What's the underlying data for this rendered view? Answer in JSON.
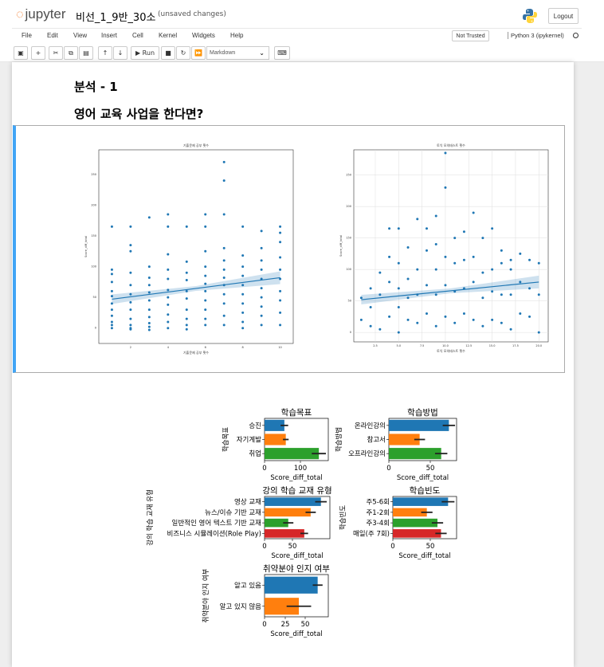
{
  "header": {
    "logo_text": "jupyter",
    "notebook_name": "비선_1_9반_30소",
    "save_status": "(unsaved changes)",
    "logout_label": "Logout"
  },
  "menubar": {
    "items": [
      "File",
      "Edit",
      "View",
      "Insert",
      "Cell",
      "Kernel",
      "Widgets",
      "Help"
    ],
    "trust_label": "Not Trusted",
    "kernel_label": "Python 3 (ipykernel)"
  },
  "toolbar": {
    "run_label": "Run",
    "cell_type": "Markdown",
    "icons": [
      "save-icon",
      "plus-icon",
      "cut-icon",
      "copy-icon",
      "paste-icon",
      "arrow-up-icon",
      "arrow-down-icon",
      "run-icon",
      "stop-icon",
      "restart-icon",
      "fast-forward-icon",
      "keyboard-icon"
    ]
  },
  "notebook": {
    "heading1": "분석 - 1",
    "heading2": "영어 교육 사업을 한다면?"
  },
  "colors": {
    "blue": "#1f77b4",
    "orange": "#ff7f0e",
    "green": "#2ca02c",
    "red": "#d62728",
    "cell_accent": "#42a5f5"
  },
  "chart_data": [
    {
      "type": "scatter",
      "title": "기출문제 공부 횟수",
      "xlabel": "기출문제 공부 횟수",
      "ylabel": "Score_diff_total",
      "xticks": [
        "2",
        "4",
        "6",
        "8",
        "10"
      ],
      "yticks": [
        "0",
        "50",
        "100",
        "150",
        "200",
        "250"
      ],
      "xlim": [
        0.3,
        10.7
      ],
      "ylim": [
        -25,
        290
      ],
      "regression": {
        "x": [
          1,
          10
        ],
        "y": [
          47,
          82
        ]
      },
      "x": [
        1,
        1,
        1,
        1,
        1,
        1,
        1,
        1,
        1,
        1,
        1,
        1,
        2,
        2,
        2,
        2,
        2,
        2,
        2,
        2,
        2,
        2,
        2,
        2,
        3,
        3,
        3,
        3,
        3,
        3,
        3,
        3,
        3,
        3,
        3,
        4,
        4,
        4,
        4,
        4,
        4,
        4,
        4,
        4,
        4,
        4,
        5,
        5,
        5,
        5,
        5,
        5,
        5,
        5,
        5,
        5,
        6,
        6,
        6,
        6,
        6,
        6,
        6,
        6,
        6,
        6,
        6,
        7,
        7,
        7,
        7,
        7,
        7,
        7,
        7,
        7,
        7,
        7,
        7,
        8,
        8,
        8,
        8,
        8,
        8,
        8,
        8,
        8,
        8,
        9,
        9,
        9,
        9,
        9,
        9,
        9,
        9,
        9,
        9,
        10,
        10,
        10,
        10,
        10,
        10,
        10,
        10,
        10,
        10
      ],
      "y": [
        165,
        95,
        88,
        75,
        60,
        52,
        40,
        30,
        20,
        10,
        5,
        0,
        165,
        135,
        125,
        90,
        70,
        55,
        42,
        30,
        15,
        5,
        0,
        -2,
        180,
        100,
        82,
        70,
        58,
        45,
        30,
        18,
        8,
        2,
        -3,
        185,
        165,
        120,
        95,
        80,
        62,
        50,
        38,
        22,
        10,
        0,
        165,
        108,
        90,
        78,
        60,
        48,
        30,
        15,
        5,
        -2,
        185,
        165,
        125,
        100,
        85,
        72,
        60,
        45,
        30,
        15,
        5,
        270,
        240,
        185,
        130,
        110,
        95,
        82,
        70,
        55,
        40,
        20,
        5,
        165,
        118,
        100,
        85,
        70,
        55,
        40,
        25,
        10,
        0,
        158,
        130,
        110,
        95,
        80,
        65,
        50,
        35,
        20,
        5,
        165,
        155,
        140,
        115,
        95,
        80,
        60,
        45,
        25,
        5
      ]
    },
    {
      "type": "scatter",
      "title": "토익 모의테스트 횟수",
      "xlabel": "토익 모의테스트 횟수",
      "ylabel": "Score_diff_total",
      "xticks": [
        "2.5",
        "5.0",
        "7.5",
        "10.0",
        "12.5",
        "15.0",
        "17.5",
        "20.0"
      ],
      "yticks": [
        "0",
        "50",
        "100",
        "150",
        "200",
        "250"
      ],
      "xlim": [
        0.2,
        21
      ],
      "ylim": [
        -15,
        290
      ],
      "regression": {
        "x": [
          1,
          20
        ],
        "y": [
          52,
          80
        ]
      },
      "x": [
        1,
        1,
        2,
        2,
        2,
        3,
        3,
        3,
        4,
        4,
        4,
        4,
        5,
        5,
        5,
        5,
        5,
        6,
        6,
        6,
        6,
        7,
        7,
        7,
        7,
        8,
        8,
        8,
        8,
        9,
        9,
        9,
        9,
        9,
        10,
        10,
        10,
        10,
        10,
        11,
        11,
        11,
        11,
        12,
        12,
        12,
        12,
        13,
        13,
        13,
        13,
        14,
        14,
        14,
        14,
        15,
        15,
        15,
        15,
        16,
        16,
        16,
        16,
        17,
        17,
        17,
        17,
        18,
        18,
        18,
        19,
        19,
        19,
        20,
        20,
        20
      ],
      "y": [
        55,
        20,
        70,
        40,
        10,
        95,
        60,
        5,
        165,
        120,
        80,
        25,
        165,
        110,
        70,
        40,
        0,
        135,
        85,
        55,
        20,
        180,
        100,
        60,
        15,
        165,
        130,
        75,
        30,
        185,
        140,
        100,
        60,
        10,
        285,
        230,
        120,
        75,
        25,
        150,
        110,
        65,
        15,
        160,
        115,
        70,
        30,
        190,
        120,
        80,
        20,
        150,
        95,
        55,
        10,
        165,
        100,
        65,
        20,
        130,
        110,
        60,
        15,
        115,
        100,
        60,
        5,
        125,
        80,
        30,
        115,
        70,
        25,
        110,
        60,
        0
      ]
    },
    {
      "type": "bar",
      "orientation": "horizontal",
      "title": "학습목표",
      "xlabel": "Score_diff_total",
      "ylabel": "학습목표",
      "categories": [
        "승진",
        "자기계발",
        "취업"
      ],
      "values": [
        42,
        45,
        115
      ],
      "error": [
        8,
        6,
        15
      ],
      "colors": [
        "#1f77b4",
        "#ff7f0e",
        "#2ca02c"
      ],
      "xticks": [
        "0",
        "100"
      ],
      "xlim": [
        0,
        135
      ]
    },
    {
      "type": "bar",
      "orientation": "horizontal",
      "title": "학습방법",
      "xlabel": "Score_diff_total",
      "ylabel": "학습방법",
      "categories": [
        "온라인강의",
        "참고서",
        "오프라인강의"
      ],
      "values": [
        78,
        40,
        68
      ],
      "error": [
        8,
        7,
        8
      ],
      "colors": [
        "#1f77b4",
        "#ff7f0e",
        "#2ca02c"
      ],
      "xticks": [
        "0",
        "50"
      ],
      "xlim": [
        0,
        88
      ]
    },
    {
      "type": "bar",
      "orientation": "horizontal",
      "title": "강의 학습 교재 유형",
      "xlabel": "Score_diff_total",
      "ylabel": "강의 학습 교재 유형",
      "categories": [
        "영상 교재",
        "뉴스/이슈 기반 교재",
        "일반적인 영어 텍스트 기반 교재",
        "비즈니스 시뮬레이션(Role Play)"
      ],
      "values": [
        88,
        72,
        37,
        62
      ],
      "error": [
        9,
        8,
        8,
        6
      ],
      "colors": [
        "#1f77b4",
        "#ff7f0e",
        "#2ca02c",
        "#d62728"
      ],
      "xticks": [
        "0",
        "50"
      ],
      "xlim": [
        0,
        102
      ]
    },
    {
      "type": "bar",
      "orientation": "horizontal",
      "title": "학습빈도",
      "xlabel": "Score_diff_total",
      "ylabel": "학습빈도",
      "categories": [
        "주5-6회",
        "주1-2회",
        "주3-4회",
        "매일(주 7회)"
      ],
      "values": [
        78,
        48,
        63,
        68
      ],
      "error": [
        9,
        8,
        8,
        8
      ],
      "colors": [
        "#1f77b4",
        "#ff7f0e",
        "#2ca02c",
        "#d62728"
      ],
      "xticks": [
        "0",
        "50"
      ],
      "xlim": [
        0,
        90
      ]
    },
    {
      "type": "bar",
      "orientation": "horizontal",
      "title": "취약분야 인지 여부",
      "xlabel": "Score_diff_total",
      "ylabel": "취약분야 인지 여부",
      "categories": [
        "알고 있음",
        "알고 있지 않음"
      ],
      "values": [
        65,
        42
      ],
      "error": [
        6,
        15
      ],
      "colors": [
        "#1f77b4",
        "#ff7f0e"
      ],
      "xticks": [
        "0",
        "25",
        "50"
      ],
      "xlim": [
        0,
        78
      ]
    }
  ]
}
